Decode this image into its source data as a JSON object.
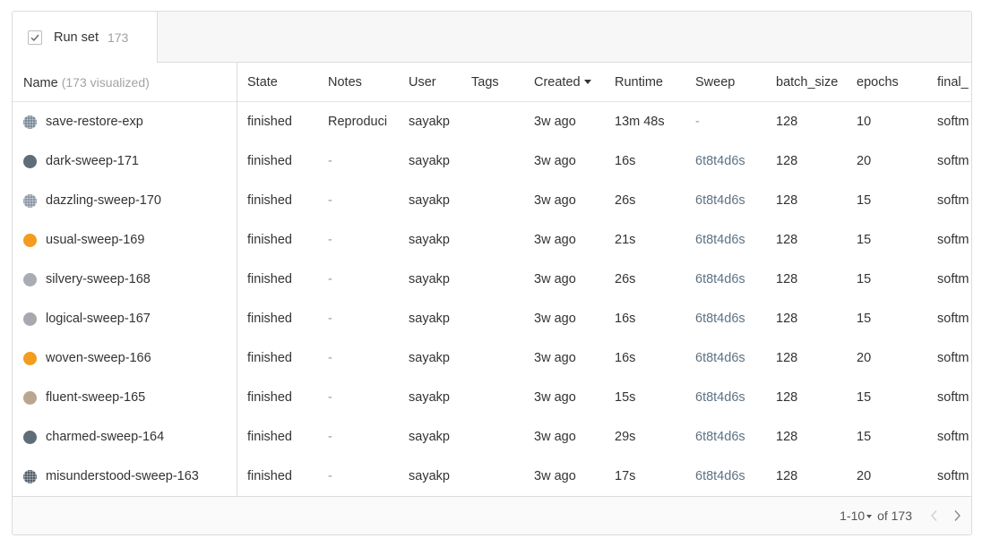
{
  "tab": {
    "label": "Run set",
    "count": "173"
  },
  "columns": {
    "name": "Name",
    "name_sub": "(173 visualized)",
    "state": "State",
    "notes": "Notes",
    "user": "User",
    "tags": "Tags",
    "created": "Created",
    "runtime": "Runtime",
    "sweep": "Sweep",
    "batch_size": "batch_size",
    "epochs": "epochs",
    "final": "final_"
  },
  "rows": [
    {
      "name": "save-restore-exp",
      "color": "#7a8a98",
      "dotted": true,
      "state": "finished",
      "notes": "Reproduci",
      "user": "sayakp",
      "tags": "",
      "created": "3w ago",
      "runtime": "13m 48s",
      "sweep": "-",
      "batch_size": "128",
      "epochs": "10",
      "final": "softm"
    },
    {
      "name": "dark-sweep-171",
      "color": "#5f6d79",
      "dotted": false,
      "state": "finished",
      "notes": "-",
      "user": "sayakp",
      "tags": "",
      "created": "3w ago",
      "runtime": "16s",
      "sweep": "6t8t4d6s",
      "batch_size": "128",
      "epochs": "20",
      "final": "softm"
    },
    {
      "name": "dazzling-sweep-170",
      "color": "#8a96a2",
      "dotted": true,
      "state": "finished",
      "notes": "-",
      "user": "sayakp",
      "tags": "",
      "created": "3w ago",
      "runtime": "26s",
      "sweep": "6t8t4d6s",
      "batch_size": "128",
      "epochs": "15",
      "final": "softm"
    },
    {
      "name": "usual-sweep-169",
      "color": "#f39c1f",
      "dotted": false,
      "state": "finished",
      "notes": "-",
      "user": "sayakp",
      "tags": "",
      "created": "3w ago",
      "runtime": "21s",
      "sweep": "6t8t4d6s",
      "batch_size": "128",
      "epochs": "15",
      "final": "softm"
    },
    {
      "name": "silvery-sweep-168",
      "color": "#a9adb3",
      "dotted": false,
      "state": "finished",
      "notes": "-",
      "user": "sayakp",
      "tags": "",
      "created": "3w ago",
      "runtime": "26s",
      "sweep": "6t8t4d6s",
      "batch_size": "128",
      "epochs": "15",
      "final": "softm"
    },
    {
      "name": "logical-sweep-167",
      "color": "#a6a9ad",
      "dotted": false,
      "state": "finished",
      "notes": "-",
      "user": "sayakp",
      "tags": "",
      "created": "3w ago",
      "runtime": "16s",
      "sweep": "6t8t4d6s",
      "batch_size": "128",
      "epochs": "15",
      "final": "softm"
    },
    {
      "name": "woven-sweep-166",
      "color": "#f39c1f",
      "dotted": false,
      "state": "finished",
      "notes": "-",
      "user": "sayakp",
      "tags": "",
      "created": "3w ago",
      "runtime": "16s",
      "sweep": "6t8t4d6s",
      "batch_size": "128",
      "epochs": "20",
      "final": "softm"
    },
    {
      "name": "fluent-sweep-165",
      "color": "#b9a68f",
      "dotted": false,
      "state": "finished",
      "notes": "-",
      "user": "sayakp",
      "tags": "",
      "created": "3w ago",
      "runtime": "15s",
      "sweep": "6t8t4d6s",
      "batch_size": "128",
      "epochs": "15",
      "final": "softm"
    },
    {
      "name": "charmed-sweep-164",
      "color": "#5f6d79",
      "dotted": false,
      "state": "finished",
      "notes": "-",
      "user": "sayakp",
      "tags": "",
      "created": "3w ago",
      "runtime": "29s",
      "sweep": "6t8t4d6s",
      "batch_size": "128",
      "epochs": "15",
      "final": "softm"
    },
    {
      "name": "misunderstood-sweep-163",
      "color": "#55606b",
      "dotted": true,
      "state": "finished",
      "notes": "-",
      "user": "sayakp",
      "tags": "",
      "created": "3w ago",
      "runtime": "17s",
      "sweep": "6t8t4d6s",
      "batch_size": "128",
      "epochs": "20",
      "final": "softm"
    }
  ],
  "pagination": {
    "range": "1-10",
    "of_label": "of 173"
  }
}
